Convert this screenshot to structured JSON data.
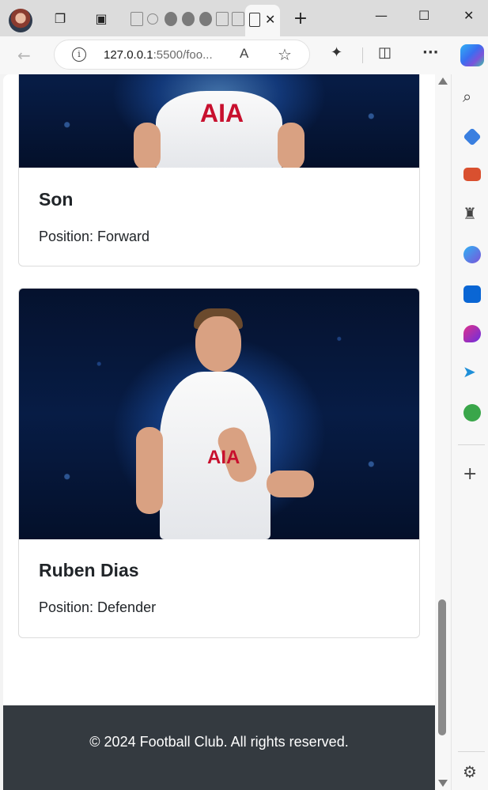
{
  "browser": {
    "address_url_host": "127.0.0.1",
    "address_url_rest": ":5500/foo...",
    "read_aloud_glyph": "A",
    "new_tab_glyph": "+",
    "close_tab_glyph": "✕",
    "more_glyph": "···",
    "add_glyph": "+",
    "settings_glyph": "⚙",
    "minimize_glyph": "—",
    "maximize_glyph": "☐",
    "close_window_glyph": "✕",
    "back_glyph": "←",
    "favorite_glyph": "☆",
    "info_glyph": "i"
  },
  "players": [
    {
      "name": "Son",
      "position": "Position: Forward",
      "sponsor": "AIA"
    },
    {
      "name": "Ruben Dias",
      "position": "Position: Defender",
      "sponsor": "AIA"
    }
  ],
  "footer": {
    "text": "© 2024 Football Club. All rights reserved."
  },
  "scroll": {
    "position_fraction": 0.93
  },
  "colors": {
    "footer_bg": "#343a40",
    "brand_copilot": "#3a6ef0",
    "accent_blue": "#0a66d4"
  },
  "sidebar_icons": [
    "search-icon",
    "tag-icon",
    "briefcase-icon",
    "chess-icon",
    "copilot-icon",
    "outlook-icon",
    "drop-icon",
    "telegram-icon",
    "tree-icon",
    "add-icon",
    "settings-icon"
  ]
}
